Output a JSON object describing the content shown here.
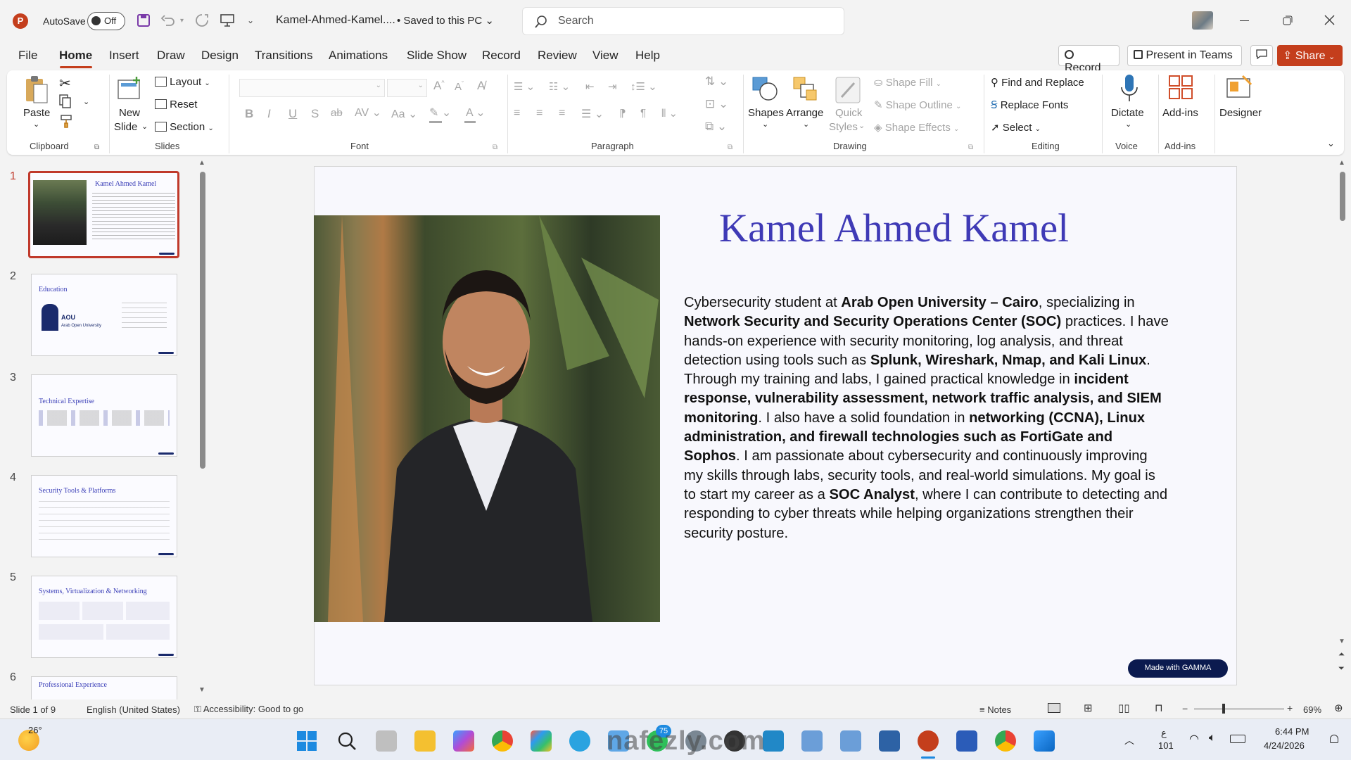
{
  "app": {
    "autosave_label": "AutoSave",
    "autosave_state": "Off",
    "file_name": "Kamel-Ahmed-Kamel....",
    "save_status": "Saved to this PC",
    "search_placeholder": "Search"
  },
  "menu": {
    "tabs": [
      "File",
      "Home",
      "Insert",
      "Draw",
      "Design",
      "Transitions",
      "Animations",
      "Slide Show",
      "Record",
      "Review",
      "View",
      "Help"
    ],
    "active_tab": "Home",
    "record_button": "Record",
    "present_button": "Present in Teams",
    "share_button": "Share"
  },
  "ribbon": {
    "clipboard": {
      "label": "Clipboard",
      "paste": "Paste"
    },
    "slides": {
      "label": "Slides",
      "new_slide_1": "New",
      "new_slide_2": "Slide",
      "layout": "Layout",
      "reset": "Reset",
      "section": "Section"
    },
    "font": {
      "label": "Font"
    },
    "paragraph": {
      "label": "Paragraph"
    },
    "drawing": {
      "label": "Drawing",
      "shapes": "Shapes",
      "arrange": "Arrange",
      "quick_styles_1": "Quick",
      "quick_styles_2": "Styles",
      "shape_fill": "Shape Fill",
      "shape_outline": "Shape Outline",
      "shape_effects": "Shape Effects"
    },
    "editing": {
      "label": "Editing",
      "find_replace": "Find and Replace",
      "replace_fonts": "Replace Fonts",
      "select": "Select"
    },
    "voice": {
      "label": "Voice",
      "dictate": "Dictate"
    },
    "addins": {
      "label": "Add-ins",
      "addins_btn": "Add-ins"
    },
    "designer": {
      "designer_btn": "Designer"
    }
  },
  "thumbnails": [
    {
      "num": "1",
      "title": "Kamel Ahmed Kamel"
    },
    {
      "num": "2",
      "title": "Education",
      "logo": "AOU",
      "logo_sub": "Arab Open University"
    },
    {
      "num": "3",
      "title": "Technical Expertise"
    },
    {
      "num": "4",
      "title": "Security Tools & Platforms"
    },
    {
      "num": "5",
      "title": "Systems, Virtualization & Networking"
    },
    {
      "num": "6",
      "title": "Professional Experience"
    }
  ],
  "slide": {
    "title": "Kamel Ahmed Kamel",
    "badge": "Made with GAMMA"
  },
  "status": {
    "slide_pos": "Slide 1 of 9",
    "language": "English (United States)",
    "accessibility": "Accessibility: Good to go",
    "notes": "Notes",
    "zoom": "69%"
  },
  "taskbar": {
    "weather_temp": "26°",
    "badge_count": "75",
    "kb_lang_1": "ع",
    "kb_lang_2": "101",
    "time": "6:44 PM",
    "date": "4/24/2026"
  },
  "watermark": {
    "text": "nafezly.com"
  },
  "colors": {
    "accent": "#c43e1c",
    "title_blue": "#3f3ab6",
    "badge_navy": "#0b1a4f",
    "share_bg": "#c43e1c"
  }
}
